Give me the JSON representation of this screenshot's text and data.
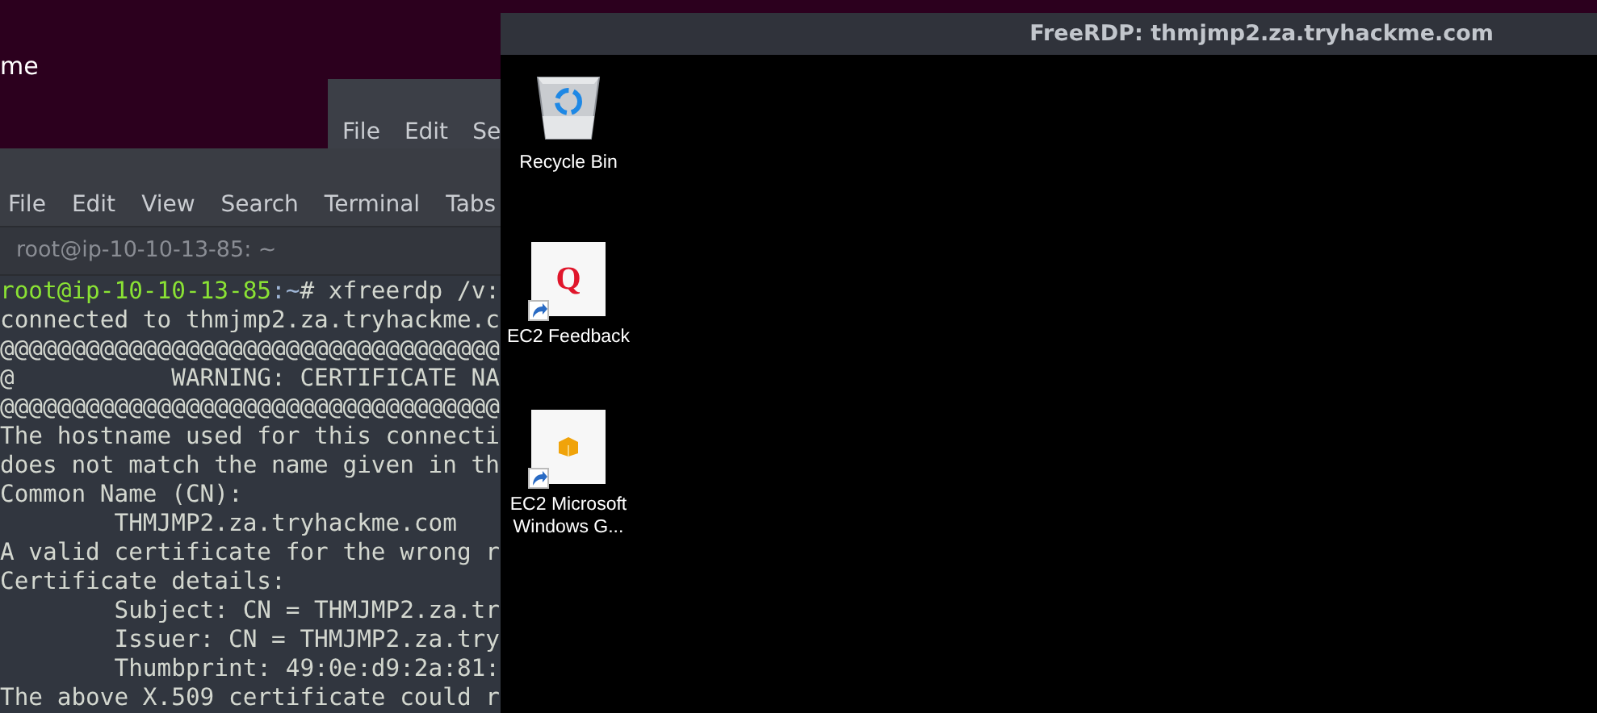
{
  "desktop": {
    "text": "me"
  },
  "back_window": {
    "menu": [
      "File",
      "Edit",
      "Se"
    ]
  },
  "terminal": {
    "menu": [
      "File",
      "Edit",
      "View",
      "Search",
      "Terminal",
      "Tabs"
    ],
    "tab": "root@ip-10-10-13-85: ~",
    "prompt": {
      "user": "root@ip-10-10-13-85",
      "path": ":~",
      "command": "# xfreerdp /v:"
    },
    "lines": [
      "connected to thmjmp2.za.tryhackme.c",
      "@@@@@@@@@@@@@@@@@@@@@@@@@@@@@@@@@@@",
      "@           WARNING: CERTIFICATE NA",
      "@@@@@@@@@@@@@@@@@@@@@@@@@@@@@@@@@@@",
      "The hostname used for this connecti",
      "does not match the name given in th",
      "Common Name (CN):",
      "        THMJMP2.za.tryhackme.com",
      "A valid certificate for the wrong r",
      "Certificate details:",
      "        Subject: CN = THMJMP2.za.tr",
      "        Issuer: CN = THMJMP2.za.try",
      "        Thumbprint: 49:0e:d9:2a:81:",
      "The above X.509 certificate could r"
    ]
  },
  "rdp": {
    "title": "FreeRDP: thmjmp2.za.tryhackme.com",
    "icons": [
      {
        "kind": "recycle",
        "label": "Recycle Bin",
        "shortcut": false
      },
      {
        "kind": "letter",
        "glyph": "Q",
        "label": "EC2 Feedback",
        "shortcut": true
      },
      {
        "kind": "cube",
        "label": "EC2 Microsoft Windows G...",
        "shortcut": true
      }
    ]
  }
}
